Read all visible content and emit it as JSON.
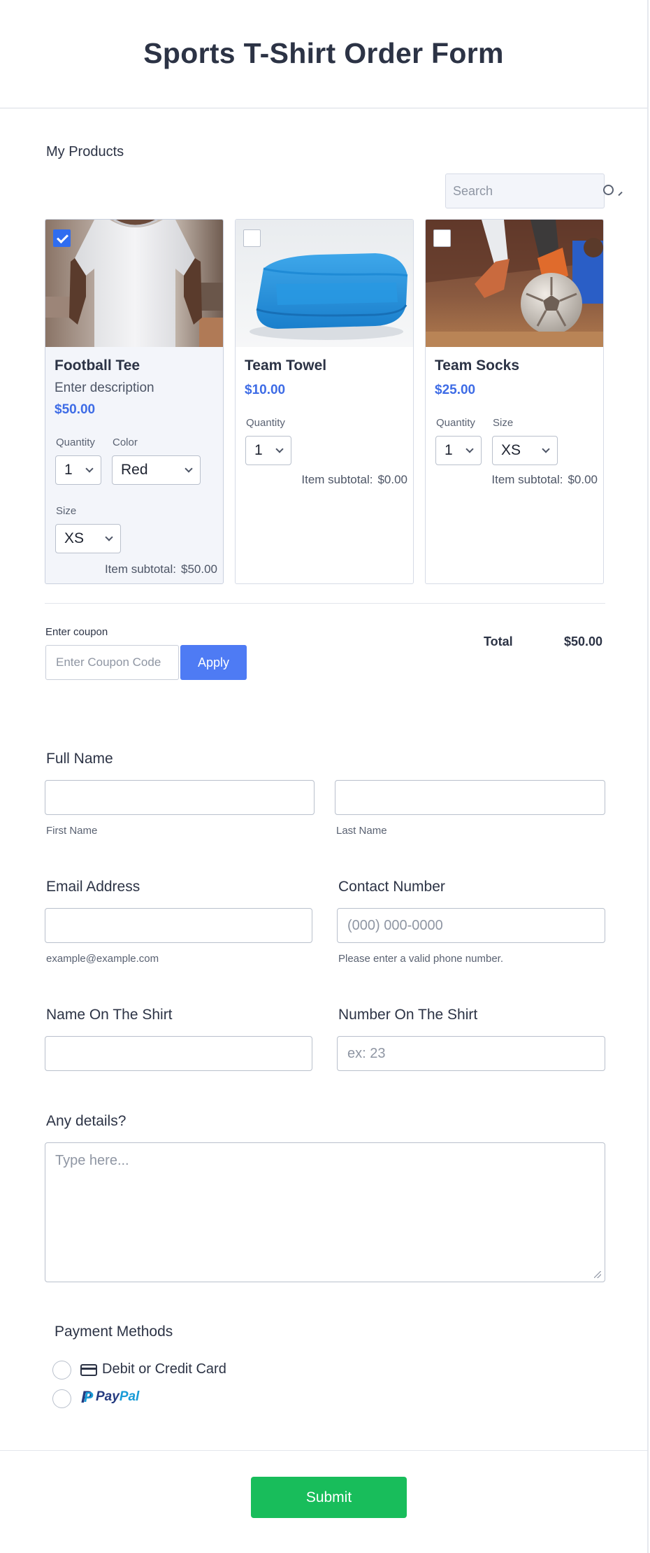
{
  "form": {
    "title": "Sports T-Shirt Order Form"
  },
  "products": {
    "section_title": "My Products",
    "search_placeholder": "Search",
    "items": [
      {
        "name": "Football Tee",
        "description": "Enter description",
        "price": "$50.00",
        "selected": true,
        "quantity_label": "Quantity",
        "quantity": "1",
        "color_label": "Color",
        "color": "Red",
        "size_label": "Size",
        "size": "XS",
        "subtotal_label": "Item subtotal:",
        "subtotal": "$50.00"
      },
      {
        "name": "Team Towel",
        "price": "$10.00",
        "selected": false,
        "quantity_label": "Quantity",
        "quantity": "1",
        "subtotal_label": "Item subtotal:",
        "subtotal": "$0.00"
      },
      {
        "name": "Team Socks",
        "price": "$25.00",
        "selected": false,
        "quantity_label": "Quantity",
        "quantity": "1",
        "size_label": "Size",
        "size": "XS",
        "subtotal_label": "Item subtotal:",
        "subtotal": "$0.00"
      }
    ]
  },
  "coupon": {
    "label": "Enter coupon",
    "placeholder": "Enter Coupon Code",
    "button": "Apply"
  },
  "total": {
    "label": "Total",
    "value": "$50.00"
  },
  "fields": {
    "full_name": {
      "label": "Full Name",
      "first_sublabel": "First Name",
      "last_sublabel": "Last Name"
    },
    "email": {
      "label": "Email Address",
      "sublabel": "example@example.com"
    },
    "contact": {
      "label": "Contact Number",
      "placeholder": "(000) 000-0000",
      "sublabel": "Please enter a valid phone number."
    },
    "shirt_name": {
      "label": "Name On The Shirt"
    },
    "shirt_number": {
      "label": "Number On The Shirt",
      "placeholder": "ex: 23"
    },
    "details": {
      "label": "Any details?",
      "placeholder": "Type here..."
    }
  },
  "payment": {
    "title": "Payment Methods",
    "card_option": "Debit or Credit Card",
    "paypal_pay": "Pay",
    "paypal_pal": "Pal"
  },
  "submit": {
    "label": "Submit"
  },
  "colors": {
    "accent": "#4e7bf4",
    "price": "#3e6ce6",
    "submit": "#18bd5b",
    "text": "#2c3345"
  }
}
